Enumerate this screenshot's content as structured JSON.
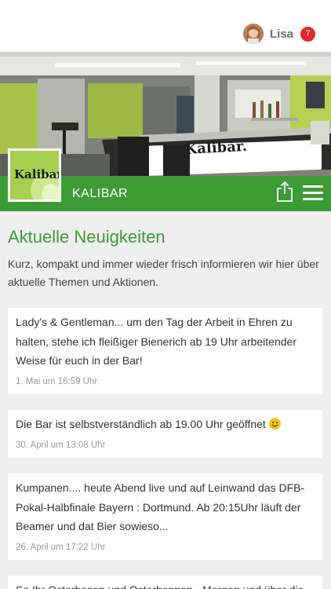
{
  "header": {
    "user_name": "Lisa",
    "notification_count": "7"
  },
  "venue": {
    "name": "KALIBAR",
    "logo_text": "Kalibar",
    "sign_text": "Kalibar."
  },
  "news": {
    "title": "Aktuelle Neuigkeiten",
    "intro": "Kurz, kompakt und immer wieder frisch informieren wir hier über aktuelle Themen und Aktionen.",
    "posts": [
      {
        "text": "Lady's & Gentleman... um den Tag der Arbeit in Ehren zu halten, stehe ich fleißiger Bienerich ab 19 Uhr arbeitender Weise für euch in der Bar!",
        "date": "1. Mai um 16:59 Uhr"
      },
      {
        "text": "Die Bar ist selbstverständlich ab 19.00 Uhr geöffnet",
        "date": "30. April um 13:08 Uhr"
      },
      {
        "text": "Kumpanen.... heute Abend live und auf Leinwand das DFB-Pokal-Halbfinale Bayern : Dortmund. Ab 20:15Uhr läuft der Beamer und dat Bier sowieso...",
        "date": "26. April um 17:22 Uhr"
      },
      {
        "text": "So Ihr Osterhasen und Osterhennen - Morgen und über die",
        "date": ""
      }
    ]
  },
  "colors": {
    "brand_green": "#3d9b35",
    "badge_red": "#e4262d"
  },
  "icons": {
    "share": "share-icon",
    "menu": "hamburger-menu-icon",
    "emoji": "smiling-face-icon"
  }
}
